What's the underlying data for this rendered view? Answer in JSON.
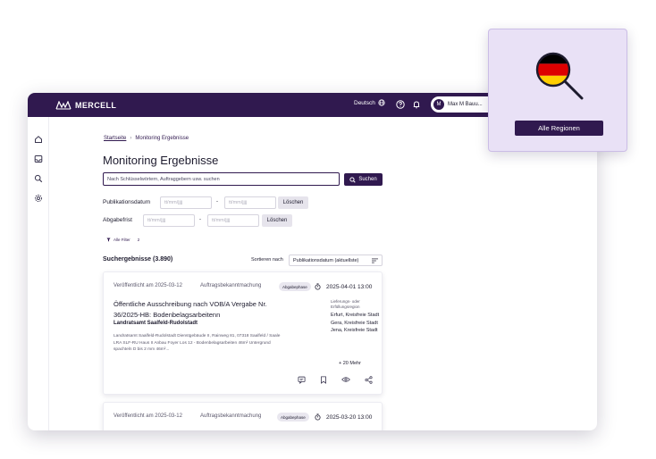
{
  "brand": {
    "name": "MERCELL",
    "accent": "#30194f"
  },
  "topbar": {
    "language": "Deutsch",
    "icons": [
      "globe-icon",
      "help-icon",
      "bell-icon"
    ],
    "user": {
      "initial": "M",
      "name": "Max M Bauu..."
    }
  },
  "sidebar": {
    "icons": [
      "home-icon",
      "inbox-icon",
      "search-icon",
      "settings-icon"
    ]
  },
  "breadcrumb": {
    "home": "Startseite",
    "separator": "›",
    "current": "Monitoring Ergebnisse"
  },
  "page_title": "Monitoring Ergebnisse",
  "search": {
    "placeholder": "Nach Schlüsselwörtern, Auftraggebern usw. suchen",
    "button": "Suchen"
  },
  "filters": {
    "publication": {
      "label": "Publikationsdatum",
      "from_placeholder": "tt/mm/jjjj",
      "to_placeholder": "tt/mm/jjjj",
      "dash": "-",
      "clear": "Löschen"
    },
    "deadline": {
      "label": "Abgabefrist",
      "from_placeholder": "tt/mm/jjjj",
      "to_placeholder": "tt/mm/jjjj",
      "dash": "-",
      "clear": "Löschen"
    },
    "all_filter": {
      "label": "Alle Filter",
      "count": "2"
    }
  },
  "results": {
    "count_label": "Suchergebnisse (3.890)",
    "sort_label": "Sortieren nach",
    "sort_value": "Publikationsdatum (aktuellste)"
  },
  "cards": [
    {
      "published": "Veröffentlicht am 2025-03-12",
      "type": "Auftragsbekanntmachung",
      "phase": "Abgabephase",
      "deadline": "2025-04-01 13:00",
      "title": "Öffentliche Ausschreibung nach VOB/A Vergabe Nr. 36/2025-HB: Bodenbelagsarbeitenn",
      "buyer": "Landratsamt Saalfeld-Rudolstadt",
      "description": "Landratsamt Saalfeld-Rudolstadt Dienstgebäude II, Rainweg 81, 07318 Saalfeld / Saale LRA SLF-RU Haus II Anbau Foyer Los 12 - Bodenbelagsarbeiten 46m² Untergrund spachteln D bis 2 mm 46m²...",
      "region_label": "Lieferungs- oder Erfüllungsregion",
      "regions": [
        "Erfurt, Kreisfreie Stadt",
        "Gera, Kreisfreie Stadt",
        "Jena, Kreisfreie Stadt"
      ],
      "more": "+ 20 Mehr"
    },
    {
      "published": "Veröffentlicht am 2025-03-12",
      "type": "Auftragsbekanntmachung",
      "phase": "Abgabephase",
      "deadline": "2025-03-20 13:00"
    }
  ],
  "region_popover": {
    "button": "Alle Regionen",
    "flag_colors": [
      "#000000",
      "#dd0000",
      "#ffce00"
    ]
  }
}
